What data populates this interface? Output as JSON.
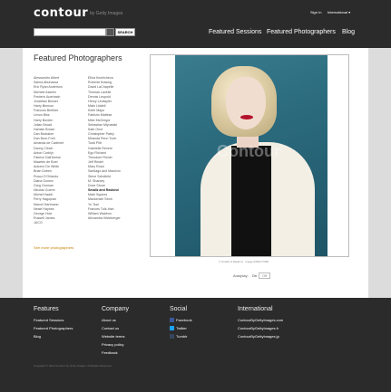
{
  "header": {
    "logo": "contour",
    "logo_sub": "by Getty Images",
    "signin": "Sign In",
    "international": "International ▾",
    "search_button": "SEARCH",
    "nav": [
      "Featured Sessions",
      "Featured Photographers",
      "Blog"
    ]
  },
  "main": {
    "title": "Featured Photographers",
    "column_left": [
      "Alessandro Albert",
      "Salma Abuhassa",
      "Eric Ryan Anderson",
      "Michele Asselin",
      "Frederic Auerbach",
      "Jonathan Becker",
      "Harry Benson",
      "Francois Berthier",
      "Levon Biss",
      "Harry Borden",
      "Julian Broad",
      "Hamish Brown",
      "Dan Brubaker",
      "Dan Burn-Forti",
      "Amanda de Cadenet",
      "Danny Clinch",
      "Anton Corbijn",
      "Fabrice Dall'Anese",
      "Maarten de Boer",
      "Autumn De Wilde",
      "Brian Doben",
      "Rocco D'Orlando",
      "Diana Gomez",
      "Greg Gorman",
      "Nicolas Guerin",
      "Michel Haddi",
      "Perry Hagopian",
      "Marcel Hartmann",
      "Neale Haynes",
      "George Holz",
      "Russell James",
      "JUCO"
    ],
    "column_right": [
      "Elina Kechicheva",
      "Roberta Krasnig",
      "David LaChapelle",
      "Thomas Lavelle",
      "Dennis Leupold",
      "Henry Leutwyler",
      "Mark Liddell",
      "Keith Major",
      "Fabrizio Maltese",
      "Mike McGregor",
      "Sebastian Mlynarski",
      "Kate Orne",
      "Christopher Patey",
      "Miranda Penn Turin",
      "Todd Plitt",
      "Gabrielle Revere",
      "Ego Richard",
      "Theodore Richer",
      "Jeff Riedel",
      "Mary Rozzi",
      "Santiago and Mauricio",
      "Steve Schofield",
      "M. Sharkey",
      "Dove Shore",
      "Smallz and Raskind",
      "Mark Squires",
      "Mackenzie Stroh",
      "Yu Tsai",
      "Frances Tulk-Hart",
      "William Waldron",
      "Alexandra Weinberger"
    ],
    "highlighted": "Smallz and Raskind",
    "more_link": "See more photographers",
    "photo_watermark": "Contour",
    "caption": "© Smallz & Raskind · Image #459177066",
    "autoplay_label": "Autoplay:",
    "autoplay_on": "On",
    "autoplay_off": "Off"
  },
  "footer": {
    "columns": [
      {
        "title": "Features",
        "items": [
          "Featured Sessions",
          "Featured Photographers",
          "Blog"
        ]
      },
      {
        "title": "Company",
        "items": [
          "About us",
          "Contact us",
          "Website terms",
          "Privacy policy",
          "Feedback"
        ]
      },
      {
        "title": "Social",
        "items": [
          "Facebook",
          "Twitter",
          "Tumblr"
        ]
      },
      {
        "title": "International",
        "items": [
          "ContourByGettyImages.com",
          "ContourByGettyImages.fr",
          "ContourByGettyImages.jp"
        ]
      }
    ],
    "copyright": "Copyright © 2014 Contour by Getty Images. All Rights Reserved.",
    "social_colors": {
      "facebook": "#3b5998",
      "twitter": "#1da1f2",
      "tumblr": "#35465c"
    }
  },
  "colors": {
    "header_bg": "#2b2b2b",
    "page_bg": "#dcdcdc",
    "link_accent": "#c77d00"
  }
}
